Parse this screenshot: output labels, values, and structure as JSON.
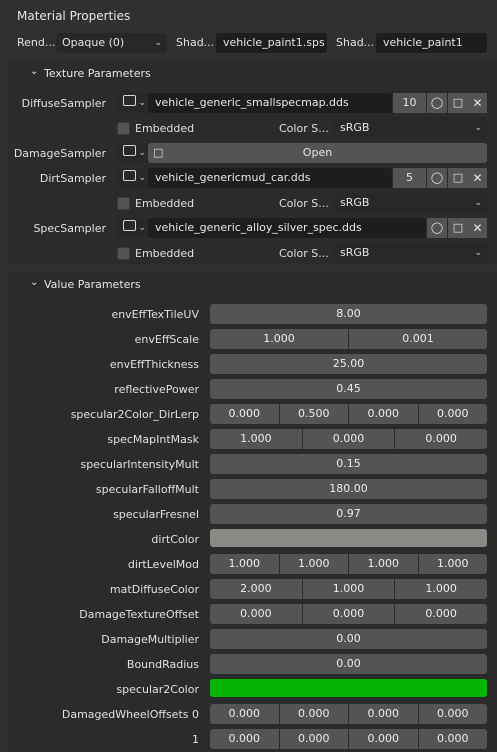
{
  "header": {
    "title": "Material Properties",
    "render_label": "Rend...",
    "render_value": "Opaque (0)",
    "shader1_label": "Shad...",
    "shader1_value": "vehicle_paint1.sps",
    "shader2_label": "Shad...",
    "shader2_value": "vehicle_paint1"
  },
  "texture_section": {
    "title": "Texture Parameters",
    "samplers": [
      {
        "label": "DiffuseSampler",
        "file": "vehicle_generic_smallspecmap.dds",
        "number": "10",
        "embedded_label": "Embedded",
        "colorspace_label": "Color S...",
        "colorspace": "sRGB"
      },
      {
        "label": "DamageSampler",
        "open_label": "Open"
      },
      {
        "label": "DirtSampler",
        "file": "vehicle_genericmud_car.dds",
        "number": "5",
        "embedded_label": "Embedded",
        "colorspace_label": "Color S...",
        "colorspace": "sRGB"
      },
      {
        "label": "SpecSampler",
        "file": "vehicle_generic_alloy_silver_spec.dds",
        "embedded_label": "Embedded",
        "colorspace_label": "Color S...",
        "colorspace": "sRGB"
      }
    ]
  },
  "value_section": {
    "title": "Value Parameters",
    "params": [
      {
        "label": "envEffTexTileUV",
        "values": [
          "8.00"
        ]
      },
      {
        "label": "envEffScale",
        "values": [
          "1.000",
          "0.001"
        ]
      },
      {
        "label": "envEffThickness",
        "values": [
          "25.00"
        ]
      },
      {
        "label": "reflectivePower",
        "values": [
          "0.45"
        ]
      },
      {
        "label": "specular2Color_DirLerp",
        "values": [
          "0.000",
          "0.500",
          "0.000",
          "0.000"
        ]
      },
      {
        "label": "specMapIntMask",
        "values": [
          "1.000",
          "0.000",
          "0.000"
        ]
      },
      {
        "label": "specularIntensityMult",
        "values": [
          "0.15"
        ]
      },
      {
        "label": "specularFalloffMult",
        "values": [
          "180.00"
        ]
      },
      {
        "label": "specularFresnel",
        "values": [
          "0.97"
        ]
      },
      {
        "label": "dirtColor",
        "color": "#8c8a85"
      },
      {
        "label": "dirtLevelMod",
        "values": [
          "1.000",
          "1.000",
          "1.000",
          "1.000"
        ]
      },
      {
        "label": "matDiffuseColor",
        "values": [
          "2.000",
          "1.000",
          "1.000"
        ]
      },
      {
        "label": "DamageTextureOffset",
        "values": [
          "0.000",
          "0.000",
          "0.000"
        ]
      },
      {
        "label": "DamageMultiplier",
        "values": [
          "0.00"
        ]
      },
      {
        "label": "BoundRadius",
        "values": [
          "0.00"
        ]
      },
      {
        "label": "specular2Color",
        "color": "#06b606"
      },
      {
        "label": "DamagedWheelOffsets 0",
        "values": [
          "0.000",
          "0.000",
          "0.000",
          "0.000"
        ]
      },
      {
        "label": "1",
        "values": [
          "0.000",
          "0.000",
          "0.000",
          "0.000"
        ]
      }
    ]
  },
  "colors": {
    "background": "#303030",
    "panel": "#2b2b2b",
    "field": "#1d1d1d",
    "button": "#545454",
    "accent_green": "#06b606"
  }
}
